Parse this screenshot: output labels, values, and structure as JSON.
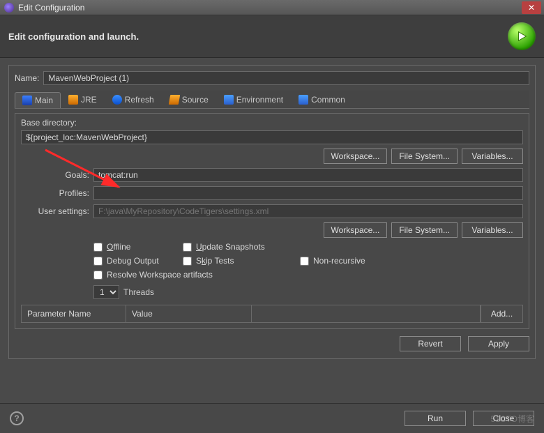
{
  "window": {
    "title": "Edit Configuration"
  },
  "header": {
    "title": "Edit configuration and launch."
  },
  "name": {
    "label": "Name:",
    "value": "MavenWebProject (1)"
  },
  "tabs": {
    "main": "Main",
    "jre": "JRE",
    "refresh": "Refresh",
    "source": "Source",
    "environment": "Environment",
    "common": "Common"
  },
  "main": {
    "base_dir_label": "Base directory:",
    "base_dir_value": "${project_loc:MavenWebProject}",
    "goals_label": "Goals:",
    "goals_value": "tomcat:run",
    "profiles_label": "Profiles:",
    "profiles_value": "",
    "user_settings_label": "User settings:",
    "user_settings_placeholder": "F:\\java\\MyRepository\\CodeTigers\\settings.xml",
    "checks": {
      "offline": "Offline",
      "update_snapshots": "Update Snapshots",
      "debug_output": "Debug Output",
      "skip_tests": "Skip Tests",
      "non_recursive": "Non-recursive",
      "resolve_ws": "Resolve Workspace artifacts"
    },
    "threads": {
      "value": "1",
      "label": "Threads"
    },
    "table": {
      "col1": "Parameter Name",
      "col2": "Value",
      "add": "Add..."
    }
  },
  "buttons": {
    "workspace": "Workspace...",
    "file_system": "File System...",
    "variables": "Variables...",
    "revert": "Revert",
    "apply": "Apply",
    "run": "Run",
    "close": "Close"
  },
  "watermark": "51CTO博客"
}
